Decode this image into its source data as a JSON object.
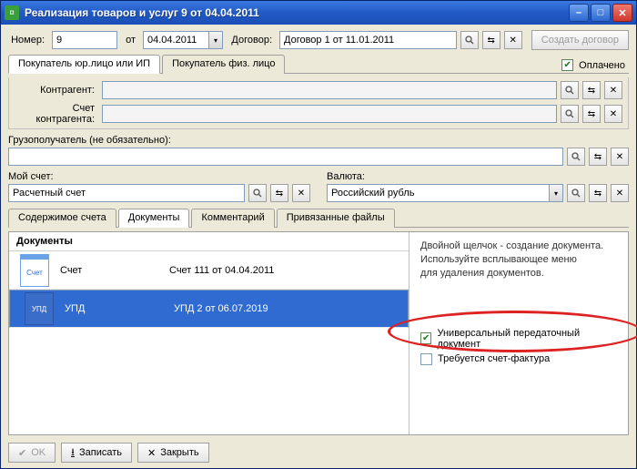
{
  "title": "Реализация товаров и услуг 9 от 04.04.2011",
  "topbar": {
    "number_label": "Номер:",
    "number": "9",
    "from_label": "от",
    "date": "04.04.2011",
    "contract_label": "Договор:",
    "contract": "Договор 1 от 11.01.2011",
    "create_contract_btn": "Создать договор",
    "paid_label": "Оплачено"
  },
  "buyer_tabs": {
    "legal": "Покупатель юр.лицо или ИП",
    "person": "Покупатель физ. лицо"
  },
  "contragent": {
    "label": "Контрагент:",
    "account_label": "Счет контрагента:"
  },
  "consignee_label": "Грузополучатель (не обязательно):",
  "myacc": {
    "label": "Мой счет:",
    "value": "Расчетный счет"
  },
  "currency": {
    "label": "Валюта:",
    "value": "Российский рубль"
  },
  "tabs": {
    "t1": "Содержимое счета",
    "t2": "Документы",
    "t3": "Комментарий",
    "t4": "Привязанные файлы"
  },
  "docs": {
    "header": "Документы",
    "hint1": "Двойной щелчок - создание документа.",
    "hint2": "Используйте всплывающее меню",
    "hint3": "для удаления документов.",
    "r0_ico": "Счет",
    "r0_type": "Счет",
    "r0_desc": "Счет 111 от 04.04.2011",
    "r1_ico": "УПД",
    "r1_type": "УПД",
    "r1_desc": "УПД 2 от 06.07.2019",
    "chk_upd": "Универсальный передаточный документ",
    "chk_sf": "Требуется счет-фактура"
  },
  "footer": {
    "ok": "OK",
    "save": "Записать",
    "close": "Закрыть"
  }
}
